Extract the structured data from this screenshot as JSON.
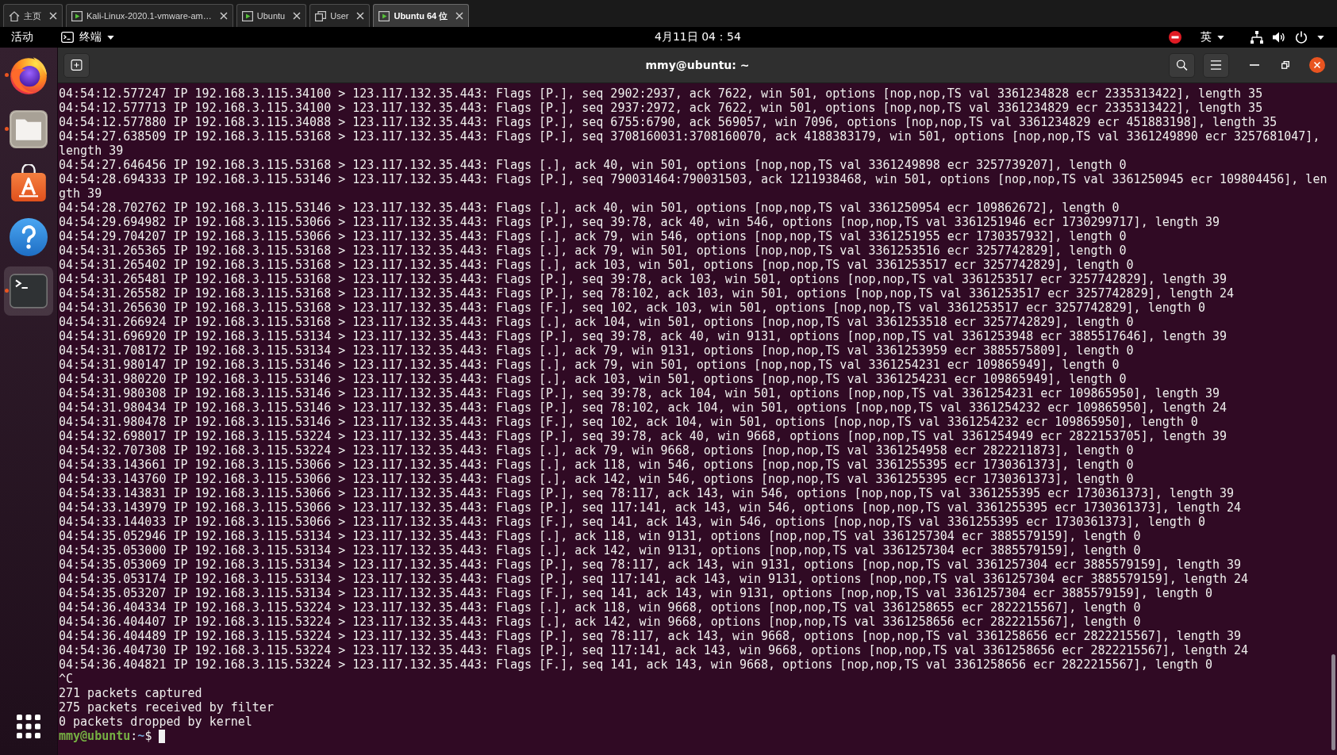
{
  "vm_tabs": [
    {
      "kind": "home",
      "label": "主页",
      "selected": false
    },
    {
      "kind": "vm",
      "label": "Kali-Linux-2020.1-vmware-am…",
      "selected": false
    },
    {
      "kind": "vm",
      "label": "Ubuntu",
      "selected": false
    },
    {
      "kind": "library",
      "label": "User",
      "selected": false
    },
    {
      "kind": "vm",
      "label": "Ubuntu 64 位",
      "selected": true
    }
  ],
  "top_bar": {
    "activities": "活动",
    "app_menu": "终端",
    "clock": "4月11日 04：54",
    "input_method": "英"
  },
  "dock": {
    "items": [
      {
        "kind": "browser",
        "running": true,
        "selected": false
      },
      {
        "kind": "files",
        "running": true,
        "selected": false
      },
      {
        "kind": "software",
        "running": false,
        "selected": false
      },
      {
        "kind": "help",
        "running": false,
        "selected": false
      },
      {
        "kind": "terminal",
        "running": true,
        "selected": true
      }
    ]
  },
  "terminal": {
    "title": "mmy@ubuntu: ~",
    "lines": [
      "04:54:12.577247 IP 192.168.3.115.34100 > 123.117.132.35.443: Flags [P.], seq 2902:2937, ack 7622, win 501, options [nop,nop,TS val 3361234828 ecr 2335313422], length 35",
      "04:54:12.577713 IP 192.168.3.115.34100 > 123.117.132.35.443: Flags [P.], seq 2937:2972, ack 7622, win 501, options [nop,nop,TS val 3361234829 ecr 2335313422], length 35",
      "04:54:12.577880 IP 192.168.3.115.34088 > 123.117.132.35.443: Flags [P.], seq 6755:6790, ack 569057, win 7096, options [nop,nop,TS val 3361234829 ecr 451883198], length 35",
      "04:54:27.638509 IP 192.168.3.115.53168 > 123.117.132.35.443: Flags [P.], seq 3708160031:3708160070, ack 4188383179, win 501, options [nop,nop,TS val 3361249890 ecr 3257681047],",
      "length 39",
      "04:54:27.646456 IP 192.168.3.115.53168 > 123.117.132.35.443: Flags [.], ack 40, win 501, options [nop,nop,TS val 3361249898 ecr 3257739207], length 0",
      "04:54:28.694333 IP 192.168.3.115.53146 > 123.117.132.35.443: Flags [P.], seq 790031464:790031503, ack 1211938468, win 501, options [nop,nop,TS val 3361250945 ecr 109804456], len",
      "gth 39",
      "04:54:28.702762 IP 192.168.3.115.53146 > 123.117.132.35.443: Flags [.], ack 40, win 501, options [nop,nop,TS val 3361250954 ecr 109862672], length 0",
      "04:54:29.694982 IP 192.168.3.115.53066 > 123.117.132.35.443: Flags [P.], seq 39:78, ack 40, win 546, options [nop,nop,TS val 3361251946 ecr 1730299717], length 39",
      "04:54:29.704207 IP 192.168.3.115.53066 > 123.117.132.35.443: Flags [.], ack 79, win 546, options [nop,nop,TS val 3361251955 ecr 1730357932], length 0",
      "04:54:31.265365 IP 192.168.3.115.53168 > 123.117.132.35.443: Flags [.], ack 79, win 501, options [nop,nop,TS val 3361253516 ecr 3257742829], length 0",
      "04:54:31.265402 IP 192.168.3.115.53168 > 123.117.132.35.443: Flags [.], ack 103, win 501, options [nop,nop,TS val 3361253517 ecr 3257742829], length 0",
      "04:54:31.265481 IP 192.168.3.115.53168 > 123.117.132.35.443: Flags [P.], seq 39:78, ack 103, win 501, options [nop,nop,TS val 3361253517 ecr 3257742829], length 39",
      "04:54:31.265582 IP 192.168.3.115.53168 > 123.117.132.35.443: Flags [P.], seq 78:102, ack 103, win 501, options [nop,nop,TS val 3361253517 ecr 3257742829], length 24",
      "04:54:31.265630 IP 192.168.3.115.53168 > 123.117.132.35.443: Flags [F.], seq 102, ack 103, win 501, options [nop,nop,TS val 3361253517 ecr 3257742829], length 0",
      "04:54:31.266924 IP 192.168.3.115.53168 > 123.117.132.35.443: Flags [.], ack 104, win 501, options [nop,nop,TS val 3361253518 ecr 3257742829], length 0",
      "04:54:31.696920 IP 192.168.3.115.53134 > 123.117.132.35.443: Flags [P.], seq 39:78, ack 40, win 9131, options [nop,nop,TS val 3361253948 ecr 3885517646], length 39",
      "04:54:31.708172 IP 192.168.3.115.53134 > 123.117.132.35.443: Flags [.], ack 79, win 9131, options [nop,nop,TS val 3361253959 ecr 3885575809], length 0",
      "04:54:31.980147 IP 192.168.3.115.53146 > 123.117.132.35.443: Flags [.], ack 79, win 501, options [nop,nop,TS val 3361254231 ecr 109865949], length 0",
      "04:54:31.980220 IP 192.168.3.115.53146 > 123.117.132.35.443: Flags [.], ack 103, win 501, options [nop,nop,TS val 3361254231 ecr 109865949], length 0",
      "04:54:31.980308 IP 192.168.3.115.53146 > 123.117.132.35.443: Flags [P.], seq 39:78, ack 104, win 501, options [nop,nop,TS val 3361254231 ecr 109865950], length 39",
      "04:54:31.980434 IP 192.168.3.115.53146 > 123.117.132.35.443: Flags [P.], seq 78:102, ack 104, win 501, options [nop,nop,TS val 3361254232 ecr 109865950], length 24",
      "04:54:31.980478 IP 192.168.3.115.53146 > 123.117.132.35.443: Flags [F.], seq 102, ack 104, win 501, options [nop,nop,TS val 3361254232 ecr 109865950], length 0",
      "04:54:32.698017 IP 192.168.3.115.53224 > 123.117.132.35.443: Flags [P.], seq 39:78, ack 40, win 9668, options [nop,nop,TS val 3361254949 ecr 2822153705], length 39",
      "04:54:32.707308 IP 192.168.3.115.53224 > 123.117.132.35.443: Flags [.], ack 79, win 9668, options [nop,nop,TS val 3361254958 ecr 2822211873], length 0",
      "04:54:33.143661 IP 192.168.3.115.53066 > 123.117.132.35.443: Flags [.], ack 118, win 546, options [nop,nop,TS val 3361255395 ecr 1730361373], length 0",
      "04:54:33.143760 IP 192.168.3.115.53066 > 123.117.132.35.443: Flags [.], ack 142, win 546, options [nop,nop,TS val 3361255395 ecr 1730361373], length 0",
      "04:54:33.143831 IP 192.168.3.115.53066 > 123.117.132.35.443: Flags [P.], seq 78:117, ack 143, win 546, options [nop,nop,TS val 3361255395 ecr 1730361373], length 39",
      "04:54:33.143979 IP 192.168.3.115.53066 > 123.117.132.35.443: Flags [P.], seq 117:141, ack 143, win 546, options [nop,nop,TS val 3361255395 ecr 1730361373], length 24",
      "04:54:33.144033 IP 192.168.3.115.53066 > 123.117.132.35.443: Flags [F.], seq 141, ack 143, win 546, options [nop,nop,TS val 3361255395 ecr 1730361373], length 0",
      "04:54:35.052946 IP 192.168.3.115.53134 > 123.117.132.35.443: Flags [.], ack 118, win 9131, options [nop,nop,TS val 3361257304 ecr 3885579159], length 0",
      "04:54:35.053000 IP 192.168.3.115.53134 > 123.117.132.35.443: Flags [.], ack 142, win 9131, options [nop,nop,TS val 3361257304 ecr 3885579159], length 0",
      "04:54:35.053069 IP 192.168.3.115.53134 > 123.117.132.35.443: Flags [P.], seq 78:117, ack 143, win 9131, options [nop,nop,TS val 3361257304 ecr 3885579159], length 39",
      "04:54:35.053174 IP 192.168.3.115.53134 > 123.117.132.35.443: Flags [P.], seq 117:141, ack 143, win 9131, options [nop,nop,TS val 3361257304 ecr 3885579159], length 24",
      "04:54:35.053207 IP 192.168.3.115.53134 > 123.117.132.35.443: Flags [F.], seq 141, ack 143, win 9131, options [nop,nop,TS val 3361257304 ecr 3885579159], length 0",
      "04:54:36.404334 IP 192.168.3.115.53224 > 123.117.132.35.443: Flags [.], ack 118, win 9668, options [nop,nop,TS val 3361258655 ecr 2822215567], length 0",
      "04:54:36.404407 IP 192.168.3.115.53224 > 123.117.132.35.443: Flags [.], ack 142, win 9668, options [nop,nop,TS val 3361258656 ecr 2822215567], length 0",
      "04:54:36.404489 IP 192.168.3.115.53224 > 123.117.132.35.443: Flags [P.], seq 78:117, ack 143, win 9668, options [nop,nop,TS val 3361258656 ecr 2822215567], length 39",
      "04:54:36.404730 IP 192.168.3.115.53224 > 123.117.132.35.443: Flags [P.], seq 117:141, ack 143, win 9668, options [nop,nop,TS val 3361258656 ecr 2822215567], length 24",
      "04:54:36.404821 IP 192.168.3.115.53224 > 123.117.132.35.443: Flags [F.], seq 141, ack 143, win 9668, options [nop,nop,TS val 3361258656 ecr 2822215567], length 0",
      "^C",
      "271 packets captured",
      "275 packets received by filter",
      "0 packets dropped by kernel"
    ],
    "prompt": {
      "user_host": "mmy@ubuntu",
      "separator": ":",
      "path": "~",
      "symbol": "$"
    }
  }
}
